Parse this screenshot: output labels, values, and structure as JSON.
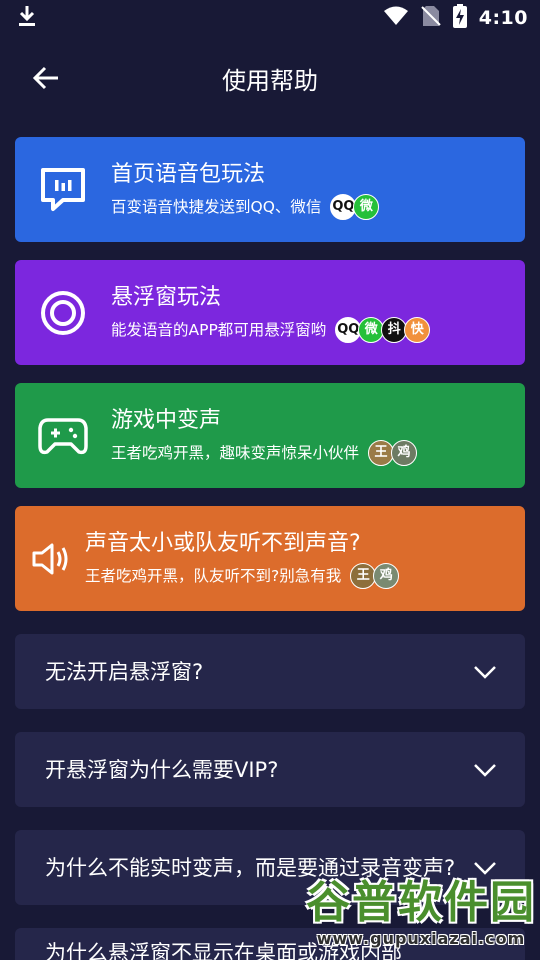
{
  "status": {
    "time": "4:10"
  },
  "header": {
    "title": "使用帮助"
  },
  "cards": [
    {
      "title": "首页语音包玩法",
      "subtitle": "百变语音快捷发送到QQ、微信",
      "color": "#2b67e0",
      "icon": "chat-bars-icon",
      "badges": [
        "QQ",
        "微"
      ]
    },
    {
      "title": "悬浮窗玩法",
      "subtitle": "能发语音的APP都可用悬浮窗哟",
      "color": "#7c27de",
      "icon": "floating-ring-icon",
      "badges": [
        "QQ",
        "微",
        "抖",
        "快"
      ]
    },
    {
      "title": "游戏中变声",
      "subtitle": "王者吃鸡开黑，趣味变声惊呆小伙伴",
      "color": "#1f9a4a",
      "icon": "gamepad-icon",
      "badges": [
        "王",
        "鸡"
      ]
    },
    {
      "title": "声音太小或队友听不到声音?",
      "subtitle": "王者吃鸡开黑，队友听不到?别急有我",
      "color": "#dc6c2c",
      "icon": "speaker-icon",
      "badges": [
        "王",
        "鸡"
      ]
    }
  ],
  "faq": [
    {
      "question": "无法开启悬浮窗?"
    },
    {
      "question": "开悬浮窗为什么需要VIP?"
    },
    {
      "question": "为什么不能实时变声，而是要通过录音变声?"
    },
    {
      "question": "为什么悬浮窗不显示在桌面或游戏内部"
    }
  ],
  "watermark": {
    "title": "谷普软件园",
    "url": "www.gupuxiazai.com"
  }
}
